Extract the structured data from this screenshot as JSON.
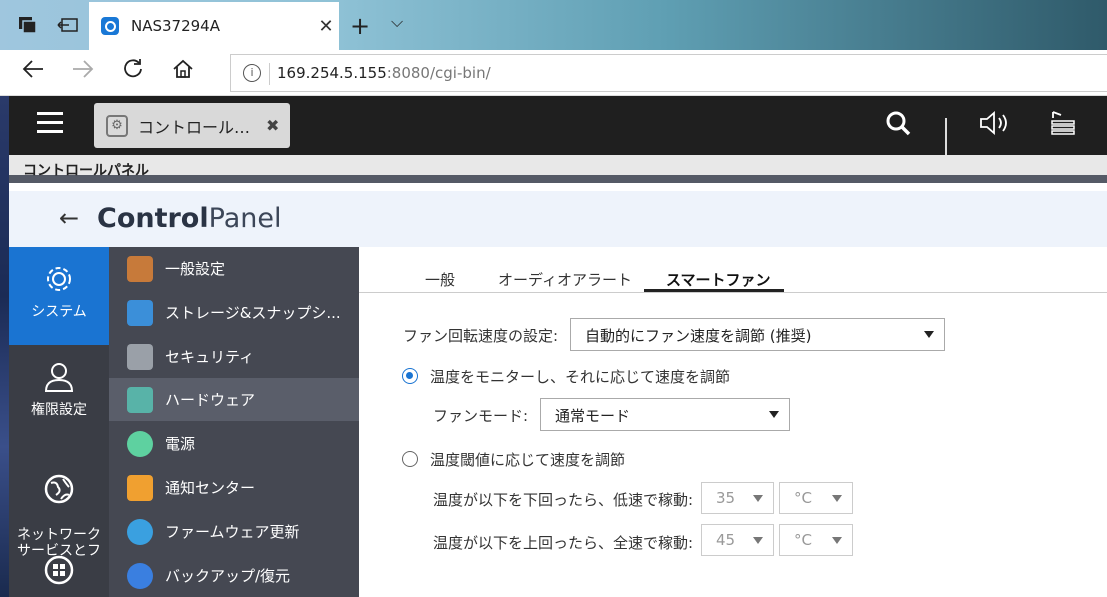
{
  "browser": {
    "tab_title": "NAS37294A",
    "tab_close": "✕",
    "new_tab": "+",
    "tab_menu": "⌵",
    "url_host": "169.254.5.155",
    "url_rest": ":8080/cgi-bin/",
    "info_symbol": "i"
  },
  "app": {
    "open_tab_label": "コントロール…",
    "open_tab_close": "✖",
    "breadcrumb": "コントロールパネル",
    "header_bold": "Control",
    "header_light": "Panel",
    "back_symbol": "←"
  },
  "categories": [
    {
      "label": "システム",
      "icon": "gear-icon"
    },
    {
      "label": "権限設定",
      "icon": "user-icon"
    },
    {
      "label": "ネットワーク\nサービスとフ",
      "icon": "globe-icon"
    },
    {
      "label": "",
      "icon": "apps-icon"
    }
  ],
  "submenu": [
    {
      "label": "一般設定",
      "icon": "general-settings-icon",
      "color": "#c77a3a"
    },
    {
      "label": "ストレージ&スナップシ...",
      "icon": "storage-icon",
      "color": "#3b8fd9"
    },
    {
      "label": "セキュリティ",
      "icon": "lock-icon",
      "color": "#9aa0a8"
    },
    {
      "label": "ハードウェア",
      "icon": "hardware-icon",
      "color": "#58b3a8"
    },
    {
      "label": "電源",
      "icon": "power-icon",
      "color": "#5ed1a0"
    },
    {
      "label": "通知センター",
      "icon": "notification-icon",
      "color": "#f0a030"
    },
    {
      "label": "ファームウェア更新",
      "icon": "firmware-icon",
      "color": "#3aa0e0"
    },
    {
      "label": "バックアップ/復元",
      "icon": "backup-icon",
      "color": "#3a7fe0"
    }
  ],
  "tabs": [
    "一般",
    "オーディオアラート",
    "スマートファン"
  ],
  "smartfan": {
    "speed_label": "ファン回転速度の設定:",
    "speed_value": "自動的にファン速度を調節 (推奨)",
    "option1": "温度をモニターし、それに応じて速度を調節",
    "fan_mode_label": "ファンモード:",
    "fan_mode_value": "通常モード",
    "option2": "温度閾値に応じて速度を調節",
    "low_label": "温度が以下を下回ったら、低速で稼動:",
    "low_value": "35",
    "low_unit": "°C",
    "high_label": "温度が以下を上回ったら、全速で稼動:",
    "high_value": "45",
    "high_unit": "°C"
  }
}
